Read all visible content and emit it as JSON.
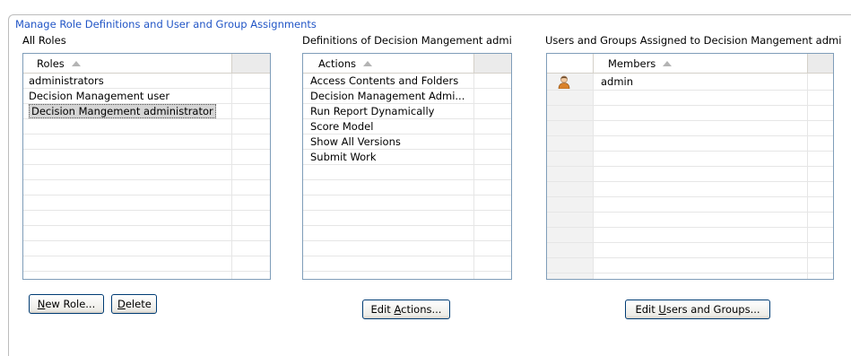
{
  "group": {
    "title": "Manage Role Definitions and User and Group Assignments"
  },
  "roles_panel": {
    "title": "All Roles",
    "column_header": "Roles",
    "rows": [
      "administrators",
      "Decision Management user",
      "Decision Mangement administrator"
    ],
    "selected_row": "Decision Mangement administrator",
    "buttons": {
      "new_role": {
        "label": "New Role...",
        "mnemonic": "N",
        "rest": "ew Role..."
      },
      "delete": {
        "label": "Delete",
        "mnemonic": "D",
        "rest": "elete"
      }
    }
  },
  "actions_panel": {
    "title": "Definitions of Decision Mangement admi",
    "column_header": "Actions",
    "rows": [
      "Access Contents and Folders",
      "Decision Management Admi...",
      "Run Report Dynamically",
      "Score Model",
      "Show All Versions",
      "Submit Work"
    ],
    "button": {
      "label": "Edit Actions...",
      "before": "Edit ",
      "mnemonic": "A",
      "after": "ctions..."
    }
  },
  "members_panel": {
    "title": "Users and Groups Assigned to Decision Mangement admi",
    "column_header": "Members",
    "rows": [
      {
        "icon": "user-icon",
        "name": "admin"
      }
    ],
    "button": {
      "label": "Edit Users and Groups...",
      "before": "Edit ",
      "mnemonic": "U",
      "after": "sers and Groups..."
    }
  },
  "colors": {
    "legend": "#2155c6",
    "table_border": "#7f9db9",
    "button_border": "#003c74"
  }
}
